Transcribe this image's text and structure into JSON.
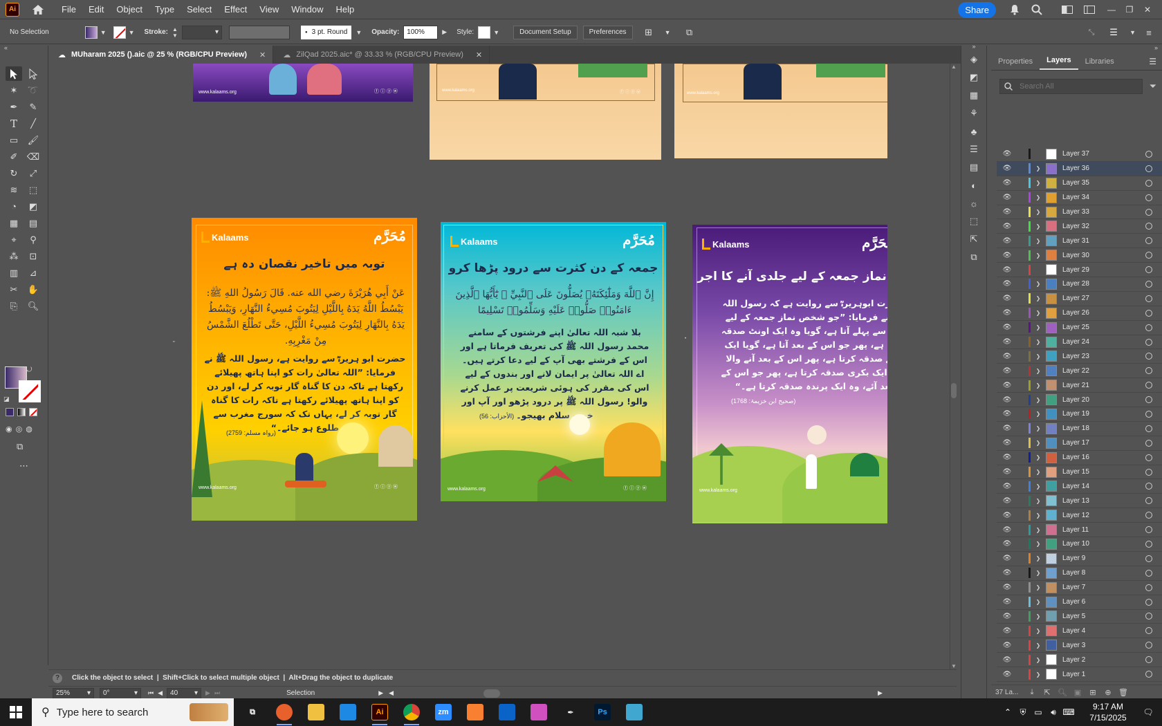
{
  "menubar": {
    "app_logo": "Ai",
    "items": [
      "File",
      "Edit",
      "Object",
      "Type",
      "Select",
      "Effect",
      "View",
      "Window",
      "Help"
    ],
    "share_label": "Share"
  },
  "control": {
    "selection": "No Selection",
    "stroke_label": "Stroke:",
    "brush": "3 pt. Round",
    "opacity_label": "Opacity:",
    "opacity_value": "100%",
    "style_label": "Style:",
    "document_setup": "Document Setup",
    "preferences": "Preferences"
  },
  "tabs": [
    {
      "label": "MUharam 2025 ().aic @ 25 % (RGB/CPU Preview)",
      "active": true
    },
    {
      "label": "ZilQad 2025.aic* @ 33.33 % (RGB/CPU Preview)",
      "active": false
    }
  ],
  "artboards": {
    "top_left": {
      "url": "www.kalaams.org"
    },
    "top_middle": {
      "url": "www.kalaams.org"
    },
    "top_right": {
      "url": "www.kalaams.org"
    },
    "orange": {
      "brand": "Kalaams",
      "logo": "مُحَرَّم",
      "title": "توبہ میں تاخیر نقصان دہ ہے",
      "arabic": "عَنْ أَبِي هُرَيْرَةَ رضي الله عنه. قَالَ رَسُولُ اللهِ ﷺ: يَبْسُطُ اللَّهُ يَدَهُ بِاللَّيْلِ لِيَتُوبَ مُسِيءُ النَّهَارِ، وَيَبْسُطُ يَدَهُ بِالنَّهَارِ لِيَتُوبَ مُسِيءُ اللَّيْلِ، حَتَّى تَطْلُعَ الشَّمْسُ مِنْ مَغْرِبِهِ.",
      "urdu": "حضرت ابو ہریرہؓ سے روایت ہے، رسول اللہ ﷺ نے فرمایا: ”اللہ تعالیٰ رات کو اپنا ہاتھ پھیلائے رکھتا ہے تاکہ دن کا گناہ گار توبہ کر لے، اور دن کو اپنا ہاتھ پھیلائے رکھتا ہے تاکہ رات کا گناہ گار توبہ کر لے، یہاں تک کہ سورج مغرب سے طلوع ہو جائے۔“",
      "reference": "(رواہ مسلم: 2759)",
      "url": "www.kalaams.org"
    },
    "teal": {
      "brand": "Kalaams",
      "logo": "مُحَرَّم",
      "title": "جمعہ کے دن کثرت سے درود پڑھا کرو",
      "arabic": "إِنَّ ٱللَّهَ وَمَلَٰٓئِكَتَهُۥ يُصَلُّونَ عَلَى ٱلنَّبِيِّ ۚ يَٰٓأَيُّهَا ٱلَّذِينَ ءَامَنُوا۟ صَلُّوا۟ عَلَيْهِ وَسَلِّمُوا۟ تَسْلِيمًا",
      "urdu": "بلا شبہ اللہ تعالیٰ اپنے فرشتوں کے سامنے محمد رسول اللہ ﷺ کی تعریف فرماتا ہے اور اس کے فرشتے بھی آپ کے لیے دعا کرتے ہیں۔ اے اللہ تعالیٰ پر ایمان لانے اور بندوں کے لیے اس کی مقرر کی ہوئی شریعت پر عمل کرنے والو! رسول اللہ ﷺ پر درود پڑھو اور آپ اور خوب سلام بھیجو۔",
      "reference": "(الأحزاب: 56)",
      "url": "www.kalaams.org"
    },
    "purple": {
      "brand": "Kalaams",
      "logo": "مُحَرَّم",
      "title": "نماز جمعہ کے لیے جلدی آنے کا اجر",
      "urdu": "حضرت ابوہریرہؓ سے روایت ہے کہ رسول اللہ ﷺ نے فرمایا: ”جو شخص نماز جمعہ کے لیے سب سے پہلے آتا ہے، گویا وہ ایک اونٹ صدقہ کرتا ہے، پھر جو اس کے بعد آتا ہے، گویا ایک گائے صدقہ کرتا ہے، پھر اس کے بعد آنے والا گویا ایک بکری صدقہ کرتا ہے، پھر جو اس کے بعد آئے، وہ ایک پرندہ صدقہ کرتا ہے۔“",
      "reference": "(صحیح ابن خزیمۃ: 1768)",
      "url": "www.kalaams.org"
    }
  },
  "hint": "Click the object to select  |  Shift+Click to select multiple object  |  Alt+Drag the object to duplicate",
  "status": {
    "zoom": "25%",
    "rotation": "0°",
    "artboard": "40",
    "tool": "Selection"
  },
  "panel": {
    "tabs": [
      "Properties",
      "Layers",
      "Libraries"
    ],
    "active_tab": "Layers",
    "search_placeholder": "Search All",
    "footer_count": "37 La...",
    "selected_layer": "Layer 36",
    "layers": [
      {
        "name": "Layer 37",
        "color": "#1a1a1a",
        "thumb": "#ffffff",
        "expandable": false
      },
      {
        "name": "Layer 36",
        "color": "#5a8ad8",
        "thumb": "#8a70c8",
        "expandable": true
      },
      {
        "name": "Layer 35",
        "color": "#40c8e8",
        "thumb": "#d0b040",
        "expandable": true
      },
      {
        "name": "Layer 34",
        "color": "#b040e8",
        "thumb": "#e0a030",
        "expandable": true
      },
      {
        "name": "Layer 33",
        "color": "#e8e040",
        "thumb": "#d8a840",
        "expandable": true
      },
      {
        "name": "Layer 32",
        "color": "#40e040",
        "thumb": "#d87080",
        "expandable": true
      },
      {
        "name": "Layer 31",
        "color": "#30a090",
        "thumb": "#60a0c0",
        "expandable": true
      },
      {
        "name": "Layer 30",
        "color": "#50c050",
        "thumb": "#e08040",
        "expandable": true
      },
      {
        "name": "Layer 29",
        "color": "#e04040",
        "thumb": "#ffffff",
        "expandable": false
      },
      {
        "name": "Layer 28",
        "color": "#4060e0",
        "thumb": "#4a80c0",
        "expandable": true
      },
      {
        "name": "Layer 27",
        "color": "#e0e040",
        "thumb": "#c89040",
        "expandable": true
      },
      {
        "name": "Layer 26",
        "color": "#a050c0",
        "thumb": "#e0a040",
        "expandable": true
      },
      {
        "name": "Layer 25",
        "color": "#601090",
        "thumb": "#a060c0",
        "expandable": true
      },
      {
        "name": "Layer 24",
        "color": "#906020",
        "thumb": "#50b0a0",
        "expandable": true
      },
      {
        "name": "Layer 23",
        "color": "#807040",
        "thumb": "#40a0c0",
        "expandable": true
      },
      {
        "name": "Layer 22",
        "color": "#c03030",
        "thumb": "#5080c0",
        "expandable": true
      },
      {
        "name": "Layer 21",
        "color": "#a0a020",
        "thumb": "#c09070",
        "expandable": true
      },
      {
        "name": "Layer 20",
        "color": "#2040a0",
        "thumb": "#40a080",
        "expandable": true
      },
      {
        "name": "Layer 19",
        "color": "#c02020",
        "thumb": "#4090c0",
        "expandable": true
      },
      {
        "name": "Layer 18",
        "color": "#8080e0",
        "thumb": "#7080c0",
        "expandable": true
      },
      {
        "name": "Layer 17",
        "color": "#e0c040",
        "thumb": "#5090c0",
        "expandable": true
      },
      {
        "name": "Layer 16",
        "color": "#1020a0",
        "thumb": "#d06040",
        "expandable": true
      },
      {
        "name": "Layer 15",
        "color": "#e09030",
        "thumb": "#e0a080",
        "expandable": true
      },
      {
        "name": "Layer 14",
        "color": "#4080e0",
        "thumb": "#40a0a0",
        "expandable": true
      },
      {
        "name": "Layer 13",
        "color": "#208060",
        "thumb": "#80c0d0",
        "expandable": true
      },
      {
        "name": "Layer 12",
        "color": "#b08040",
        "thumb": "#60b0d0",
        "expandable": true
      },
      {
        "name": "Layer 11",
        "color": "#20a0a0",
        "thumb": "#d07090",
        "expandable": true
      },
      {
        "name": "Layer 10",
        "color": "#108060",
        "thumb": "#40a080",
        "expandable": true
      },
      {
        "name": "Layer 9",
        "color": "#e08020",
        "thumb": "#c0d0e0",
        "expandable": true
      },
      {
        "name": "Layer 8",
        "color": "#1a1a1a",
        "thumb": "#70a0d0",
        "expandable": true
      },
      {
        "name": "Layer 7",
        "color": "#909090",
        "thumb": "#c09060",
        "expandable": true
      },
      {
        "name": "Layer 6",
        "color": "#60c0e0",
        "thumb": "#6090c0",
        "expandable": true
      },
      {
        "name": "Layer 5",
        "color": "#40a060",
        "thumb": "#70a0b0",
        "expandable": true
      },
      {
        "name": "Layer 4",
        "color": "#e04040",
        "thumb": "#e07070",
        "expandable": true
      },
      {
        "name": "Layer 3",
        "color": "#e04040",
        "thumb": "#4060a0",
        "expandable": true
      },
      {
        "name": "Layer 2",
        "color": "#e04040",
        "thumb": "#ffffff",
        "expandable": true
      },
      {
        "name": "Layer 1",
        "color": "#e04040",
        "thumb": "#ffffff",
        "expandable": true
      }
    ]
  },
  "taskbar": {
    "search_placeholder": "Type here to search",
    "time": "9:17 AM",
    "date": "7/15/2025",
    "apps": [
      {
        "name": "task-view",
        "label": "⧉",
        "bg": "transparent",
        "open": false
      },
      {
        "name": "firefox",
        "label": "",
        "bg": "#e8602c",
        "open": true
      },
      {
        "name": "file-explorer",
        "label": "",
        "bg": "#f0c040",
        "open": false
      },
      {
        "name": "vscode",
        "label": "",
        "bg": "#1e88e5",
        "open": false
      },
      {
        "name": "illustrator",
        "label": "Ai",
        "bg": "#330000",
        "open": true
      },
      {
        "name": "chrome",
        "label": "",
        "bg": "#e8e8e8",
        "open": true
      },
      {
        "name": "zoom",
        "label": "zm",
        "bg": "#2d8cff",
        "open": false
      },
      {
        "name": "xampp",
        "label": "",
        "bg": "#f98030",
        "open": false
      },
      {
        "name": "outlook",
        "label": "",
        "bg": "#0a64c8",
        "open": false
      },
      {
        "name": "photos",
        "label": "",
        "bg": "#d050c0",
        "open": false
      },
      {
        "name": "pen-tool",
        "label": "✒",
        "bg": "transparent",
        "open": false
      },
      {
        "name": "photoshop",
        "label": "Ps",
        "bg": "#001830",
        "open": false
      },
      {
        "name": "app-diamond",
        "label": "",
        "bg": "#40a8d0",
        "open": false
      }
    ]
  }
}
